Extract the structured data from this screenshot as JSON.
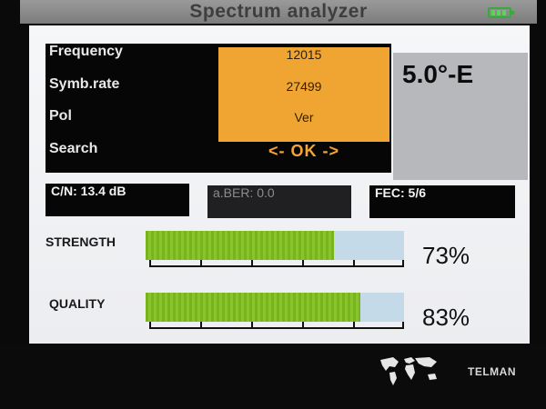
{
  "header": {
    "title": "Spectrum analyzer",
    "battery_icon": "battery-full-icon"
  },
  "params": {
    "labels": [
      "Frequency",
      "Symb.rate",
      "Pol",
      "Search"
    ],
    "frequency": "12015",
    "symbol_rate": "27499",
    "polarization": "Ver",
    "search": "<-  OK  ->"
  },
  "satellite": {
    "position": "5.0°-E"
  },
  "readouts": {
    "cn": "C/N: 13.4 dB",
    "ber": "a.BER: 0.0",
    "fec": "FEC: 5/6"
  },
  "meters": {
    "strength": {
      "label": "STRENGTH",
      "percent_text": "73%",
      "value": 0.73
    },
    "quality": {
      "label": "QUALITY",
      "percent_text": "83%",
      "value": 0.83
    }
  },
  "footer": {
    "brand": "TELMAN",
    "map_icon": "world-map-icon"
  },
  "colors": {
    "value_box": "#f0a532",
    "meter_fill": "#7dba22",
    "meter_track": "#c5dae9"
  }
}
